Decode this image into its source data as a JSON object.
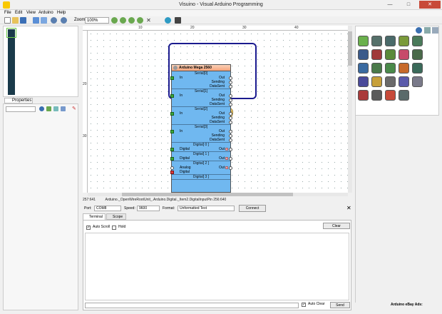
{
  "window": {
    "title": "Visuino - Visual Arduino Programming",
    "min": "—",
    "max": "□",
    "close": "✕"
  },
  "menu": [
    "File",
    "Edit",
    "View",
    "Arduino",
    "Help"
  ],
  "toolbar": {
    "zoom_label": "Zoom:",
    "zoom_value": "100%"
  },
  "properties": {
    "tab_label": "Properties"
  },
  "ruler": {
    "top_ticks": [
      "10",
      "20",
      "30",
      "40"
    ],
    "left_ticks": [
      "20",
      "30"
    ]
  },
  "component": {
    "title": "Arduino Mega 2560",
    "sections": [
      {
        "title": "Serial[0]",
        "in": "In",
        "outs": [
          "Out",
          "Sending",
          "DataSent"
        ]
      },
      {
        "title": "Serial[1]",
        "in": "In",
        "outs": [
          "Out",
          "Sending",
          "DataSent"
        ]
      },
      {
        "title": "Serial[2]",
        "in": "In",
        "outs": [
          "Out",
          "Sending",
          "DataSent"
        ]
      },
      {
        "title": "Serial[3]",
        "in": "In",
        "outs": [
          "Out",
          "Sending",
          "DataSent"
        ]
      },
      {
        "title": "Digital[ 0 ]",
        "in": "Digital",
        "outs": [
          "Out"
        ]
      },
      {
        "title": "Digital[ 1 ]",
        "in": "Digital",
        "outs": [
          "Out"
        ]
      },
      {
        "title": "Digital[ 2 ]",
        "in": "Analog",
        "in2": "Digital",
        "outs": [
          "Out"
        ]
      },
      {
        "title": "Digital[ 3 ]",
        "in": "",
        "outs": []
      }
    ]
  },
  "status": {
    "coords": "257:641",
    "path": "Arduino._OpenWireRootUnit_.Arduino.Digital._Item2.DigitalInputPin 256:640"
  },
  "serial": {
    "port_label": "Port:",
    "port_value": "COM8",
    "speed_label": "Speed:",
    "speed_value": "9600",
    "format_label": "Format:",
    "format_value": "Unformatted Text",
    "connect_label": "Connect",
    "tabs": [
      "Terminal",
      "Scope"
    ],
    "auto_scroll": "Auto Scroll",
    "hold": "Hold",
    "clear": "Clear",
    "auto_clear": "Auto Clear",
    "send": "Send"
  },
  "ads": {
    "label": "Arduino eBay Ads:"
  }
}
